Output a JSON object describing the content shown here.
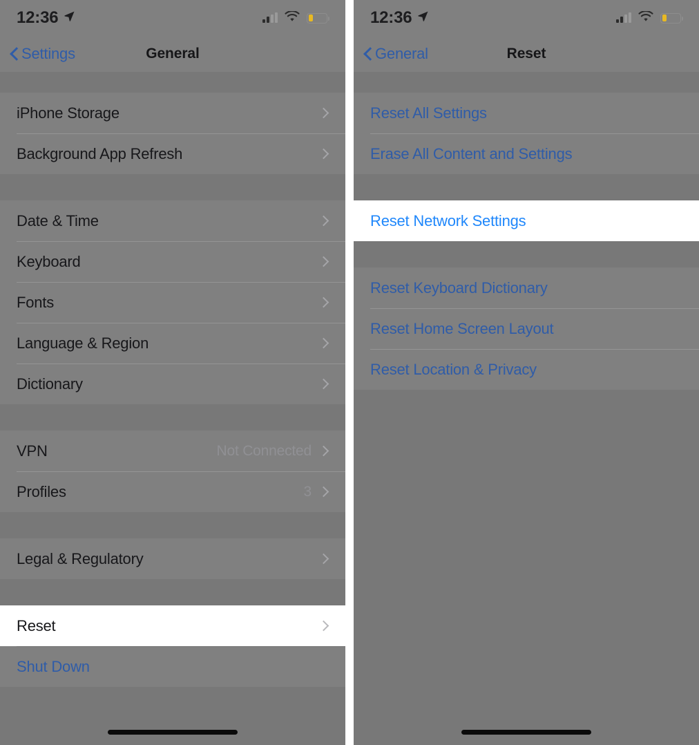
{
  "meta": {
    "accent_blue": "#1f87fb",
    "dim_blue": "#2f5ca8",
    "dim_row_bg": "#808080",
    "dim_gap_bg": "#787878",
    "highlight_bg": "#ffffff",
    "battery_color": "#e8b923"
  },
  "status_bar": {
    "time": "12:36",
    "location_icon": "location-arrow-icon",
    "signal_icon": "cellular-signal-icon",
    "wifi_icon": "wifi-icon",
    "battery_icon": "battery-low-icon"
  },
  "left_panel": {
    "nav": {
      "back_label": "Settings",
      "back_icon": "chevron-left-icon",
      "title": "General"
    },
    "sections": [
      {
        "rows": [
          {
            "label": "iPhone Storage",
            "value": "",
            "accessory": "chevron-right-icon",
            "highlighted": false,
            "style": "normal"
          },
          {
            "label": "Background App Refresh",
            "value": "",
            "accessory": "chevron-right-icon",
            "highlighted": false,
            "style": "normal"
          }
        ]
      },
      {
        "rows": [
          {
            "label": "Date & Time",
            "value": "",
            "accessory": "chevron-right-icon",
            "highlighted": false,
            "style": "normal"
          },
          {
            "label": "Keyboard",
            "value": "",
            "accessory": "chevron-right-icon",
            "highlighted": false,
            "style": "normal"
          },
          {
            "label": "Fonts",
            "value": "",
            "accessory": "chevron-right-icon",
            "highlighted": false,
            "style": "normal"
          },
          {
            "label": "Language & Region",
            "value": "",
            "accessory": "chevron-right-icon",
            "highlighted": false,
            "style": "normal"
          },
          {
            "label": "Dictionary",
            "value": "",
            "accessory": "chevron-right-icon",
            "highlighted": false,
            "style": "normal"
          }
        ]
      },
      {
        "rows": [
          {
            "label": "VPN",
            "value": "Not Connected",
            "accessory": "chevron-right-icon",
            "highlighted": false,
            "style": "normal"
          },
          {
            "label": "Profiles",
            "value": "3",
            "accessory": "chevron-right-icon",
            "highlighted": false,
            "style": "normal"
          }
        ]
      },
      {
        "rows": [
          {
            "label": "Legal & Regulatory",
            "value": "",
            "accessory": "chevron-right-icon",
            "highlighted": false,
            "style": "normal"
          }
        ]
      },
      {
        "rows": [
          {
            "label": "Reset",
            "value": "",
            "accessory": "chevron-right-icon",
            "highlighted": true,
            "style": "normal"
          },
          {
            "label": "Shut Down",
            "value": "",
            "accessory": "",
            "highlighted": false,
            "style": "action"
          }
        ]
      }
    ]
  },
  "right_panel": {
    "nav": {
      "back_label": "General",
      "back_icon": "chevron-left-icon",
      "title": "Reset"
    },
    "sections": [
      {
        "rows": [
          {
            "label": "Reset All Settings",
            "value": "",
            "accessory": "",
            "highlighted": false,
            "style": "action"
          },
          {
            "label": "Erase All Content and Settings",
            "value": "",
            "accessory": "",
            "highlighted": false,
            "style": "action"
          }
        ]
      },
      {
        "rows": [
          {
            "label": "Reset Network Settings",
            "value": "",
            "accessory": "",
            "highlighted": true,
            "style": "action-bright"
          }
        ]
      },
      {
        "rows": [
          {
            "label": "Reset Keyboard Dictionary",
            "value": "",
            "accessory": "",
            "highlighted": false,
            "style": "action"
          },
          {
            "label": "Reset Home Screen Layout",
            "value": "",
            "accessory": "",
            "highlighted": false,
            "style": "action"
          },
          {
            "label": "Reset Location & Privacy",
            "value": "",
            "accessory": "",
            "highlighted": false,
            "style": "action"
          }
        ]
      }
    ]
  }
}
